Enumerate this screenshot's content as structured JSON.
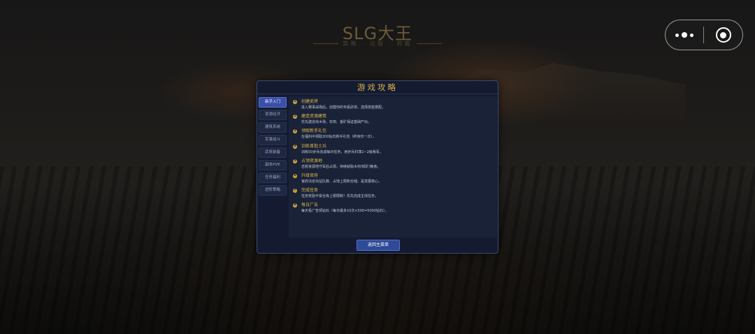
{
  "game": {
    "title": "SLG大王",
    "subtitle": "策略 · 征服 · 称霸"
  },
  "capsule": {
    "more_icon": "more-dots-icon",
    "close_icon": "target-close-icon"
  },
  "dialog": {
    "title": "游戏攻略",
    "tabs": [
      {
        "label": "新手入门",
        "active": true
      },
      {
        "label": "资源经济",
        "active": false
      },
      {
        "label": "建筑系统",
        "active": false
      },
      {
        "label": "军事战斗",
        "active": false
      },
      {
        "label": "武将装备",
        "active": false
      },
      {
        "label": "副本PVE",
        "active": false
      },
      {
        "label": "任务福利",
        "active": false
      },
      {
        "label": "进阶策略",
        "active": false
      }
    ],
    "steps": [
      {
        "num": "1",
        "name": "创建武将",
        "desc": "进入赛事战场后，创建你的专属武将，选择技能搭配。"
      },
      {
        "num": "2",
        "name": "建造资源建筑",
        "desc": "优先建造伐木场、农田、金矿保证基础产出。"
      },
      {
        "num": "3",
        "name": "领取新手礼包",
        "desc": "在福利中领取200钻石新手礼包（终身仅一次）。"
      },
      {
        "num": "4",
        "name": "训练首批士兵",
        "desc": "训练50步兵完成每日任务，用步兵扫荡1~2级叛军。"
      },
      {
        "num": "5",
        "name": "占领资源地",
        "desc": "击败资源地守军后占领，持续获取木材/铁矿/粮食。"
      },
      {
        "num": "6",
        "name": "升级官府",
        "desc": "官府决定出征队数、占地上限和仓储，是发展核心。"
      },
      {
        "num": "7",
        "name": "完成任务",
        "desc": "任务奖励不受仓库上限限制！优先完成主线任务。"
      },
      {
        "num": "8",
        "name": "每日广告",
        "desc": "每天看广告领钻石（每日最多10次×500=5000钻石）。"
      }
    ],
    "back_button": "返回主菜单"
  }
}
